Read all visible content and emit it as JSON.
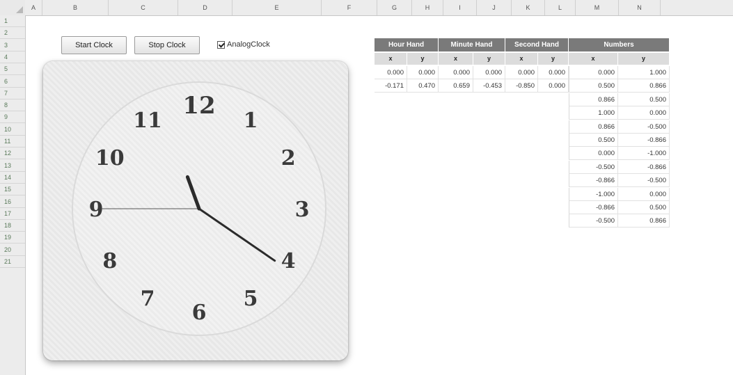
{
  "spreadsheet": {
    "columns": [
      "A",
      "B",
      "C",
      "D",
      "E",
      "F",
      "G",
      "H",
      "I",
      "J",
      "K",
      "L",
      "M",
      "N"
    ],
    "rows": [
      "1",
      "2",
      "3",
      "4",
      "5",
      "6",
      "7",
      "8",
      "9",
      "10",
      "11",
      "12",
      "13",
      "14",
      "15",
      "16",
      "17",
      "18",
      "19",
      "20",
      "21"
    ]
  },
  "controls": {
    "start_label": "Start Clock",
    "stop_label": "Stop Clock",
    "checkbox_label": "AnalogClock",
    "checkbox_checked": true
  },
  "clock": {
    "numerals": [
      "12",
      "1",
      "2",
      "3",
      "4",
      "5",
      "6",
      "7",
      "8",
      "9",
      "10",
      "11"
    ],
    "hour_hand": {
      "x": -0.171,
      "y": 0.47
    },
    "minute_hand": {
      "x": 0.659,
      "y": -0.453
    },
    "second_hand": {
      "x": -0.85,
      "y": 0.0
    }
  },
  "table": {
    "groups": [
      "Hour Hand",
      "Minute Hand",
      "Second Hand",
      "Numbers"
    ],
    "sub_headers": [
      "x",
      "y",
      "x",
      "y",
      "x",
      "y",
      "x",
      "y"
    ],
    "hand_rows": [
      [
        "0.000",
        "0.000",
        "0.000",
        "0.000",
        "0.000",
        "0.000"
      ],
      [
        "-0.171",
        "0.470",
        "0.659",
        "-0.453",
        "-0.850",
        "0.000"
      ]
    ],
    "number_rows": [
      [
        "0.000",
        "1.000"
      ],
      [
        "0.500",
        "0.866"
      ],
      [
        "0.866",
        "0.500"
      ],
      [
        "1.000",
        "0.000"
      ],
      [
        "0.866",
        "-0.500"
      ],
      [
        "0.500",
        "-0.866"
      ],
      [
        "0.000",
        "-1.000"
      ],
      [
        "-0.500",
        "-0.866"
      ],
      [
        "-0.866",
        "-0.500"
      ],
      [
        "-1.000",
        "0.000"
      ],
      [
        "-0.866",
        "0.500"
      ],
      [
        "-0.500",
        "0.866"
      ]
    ]
  }
}
